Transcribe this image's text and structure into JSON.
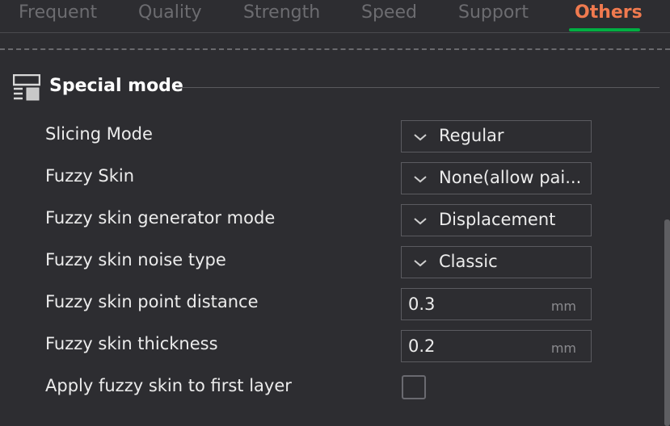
{
  "tabs": [
    {
      "label": "Frequent",
      "active": false
    },
    {
      "label": "Quality",
      "active": false
    },
    {
      "label": "Strength",
      "active": false
    },
    {
      "label": "Speed",
      "active": false
    },
    {
      "label": "Support",
      "active": false
    },
    {
      "label": "Others",
      "active": true
    }
  ],
  "section": {
    "title": "Special mode"
  },
  "settings": {
    "slicing_mode": {
      "label": "Slicing Mode",
      "value": "Regular"
    },
    "fuzzy_skin": {
      "label": "Fuzzy Skin",
      "value": "None(allow pai..."
    },
    "generator_mode": {
      "label": "Fuzzy skin generator mode",
      "value": "Displacement"
    },
    "noise_type": {
      "label": "Fuzzy skin noise type",
      "value": "Classic"
    },
    "point_distance": {
      "label": "Fuzzy skin point distance",
      "value": "0.3",
      "unit": "mm"
    },
    "thickness": {
      "label": "Fuzzy skin thickness",
      "value": "0.2",
      "unit": "mm"
    },
    "first_layer": {
      "label": "Apply fuzzy skin to first layer",
      "checked": false
    }
  },
  "colors": {
    "background": "#2d2d31",
    "active_tab": "#f07a4f",
    "tab_underline": "#00ae42",
    "inactive_tab": "#6c6c70"
  }
}
